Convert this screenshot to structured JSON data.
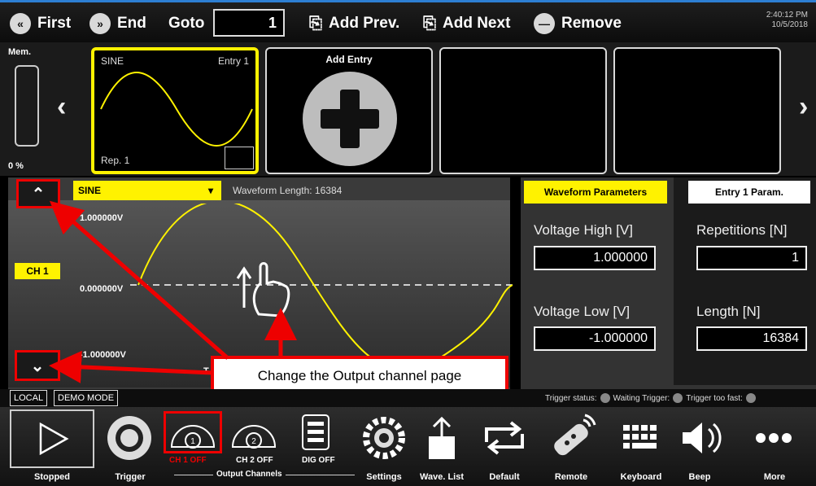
{
  "toolbar": {
    "first_label": "First",
    "end_label": "End",
    "goto_label": "Goto",
    "goto_value": "1",
    "add_prev_label": "Add Prev.",
    "add_next_label": "Add Next",
    "remove_label": "Remove",
    "clock_time": "2:40:12 PM",
    "clock_date": "10/5/2018"
  },
  "entries": {
    "mem_label": "Mem.",
    "mem_percent": "0 %",
    "card1": {
      "wave": "SINE",
      "entry": "Entry 1",
      "rep": "Rep. 1"
    },
    "card2": {
      "title": "Add Entry"
    }
  },
  "waveform": {
    "type": "SINE",
    "length_text": "Waveform Length: 16384",
    "y_high": "1.000000V",
    "y_mid": "0.000000V",
    "y_low": "-1.000000V",
    "channel": "CH 1",
    "t_label": "T"
  },
  "params": {
    "wp_tab": "Waveform Parameters",
    "ep_tab": "Entry 1 Param.",
    "voltage_high_label": "Voltage High [V]",
    "voltage_high_value": "1.000000",
    "voltage_low_label": "Voltage Low [V]",
    "voltage_low_value": "-1.000000",
    "repetitions_label": "Repetitions [N]",
    "repetitions_value": "1",
    "length_label": "Length [N]",
    "length_value": "16384"
  },
  "status": {
    "local": "LOCAL",
    "demo": "DEMO MODE",
    "trigger_status": "Trigger status:",
    "waiting": "Waiting Trigger:",
    "too_fast": "Trigger too fast:"
  },
  "callout": {
    "text": "Change the Output channel page"
  },
  "bottom": {
    "stopped": "Stopped",
    "trigger": "Trigger",
    "ch1": "CH 1 OFF",
    "ch2": "CH 2 OFF",
    "dig": "DIG OFF",
    "output_channels": "Output Channels",
    "settings": "Settings",
    "wave_list": "Wave. List",
    "default": "Default",
    "remote": "Remote",
    "keyboard": "Keyboard",
    "beep": "Beep",
    "more": "More",
    "ch1_num": "1",
    "ch2_num": "2"
  },
  "colors": {
    "accent": "#fff200",
    "highlight_red": "#e00000",
    "top_border": "#2d7fd3"
  }
}
